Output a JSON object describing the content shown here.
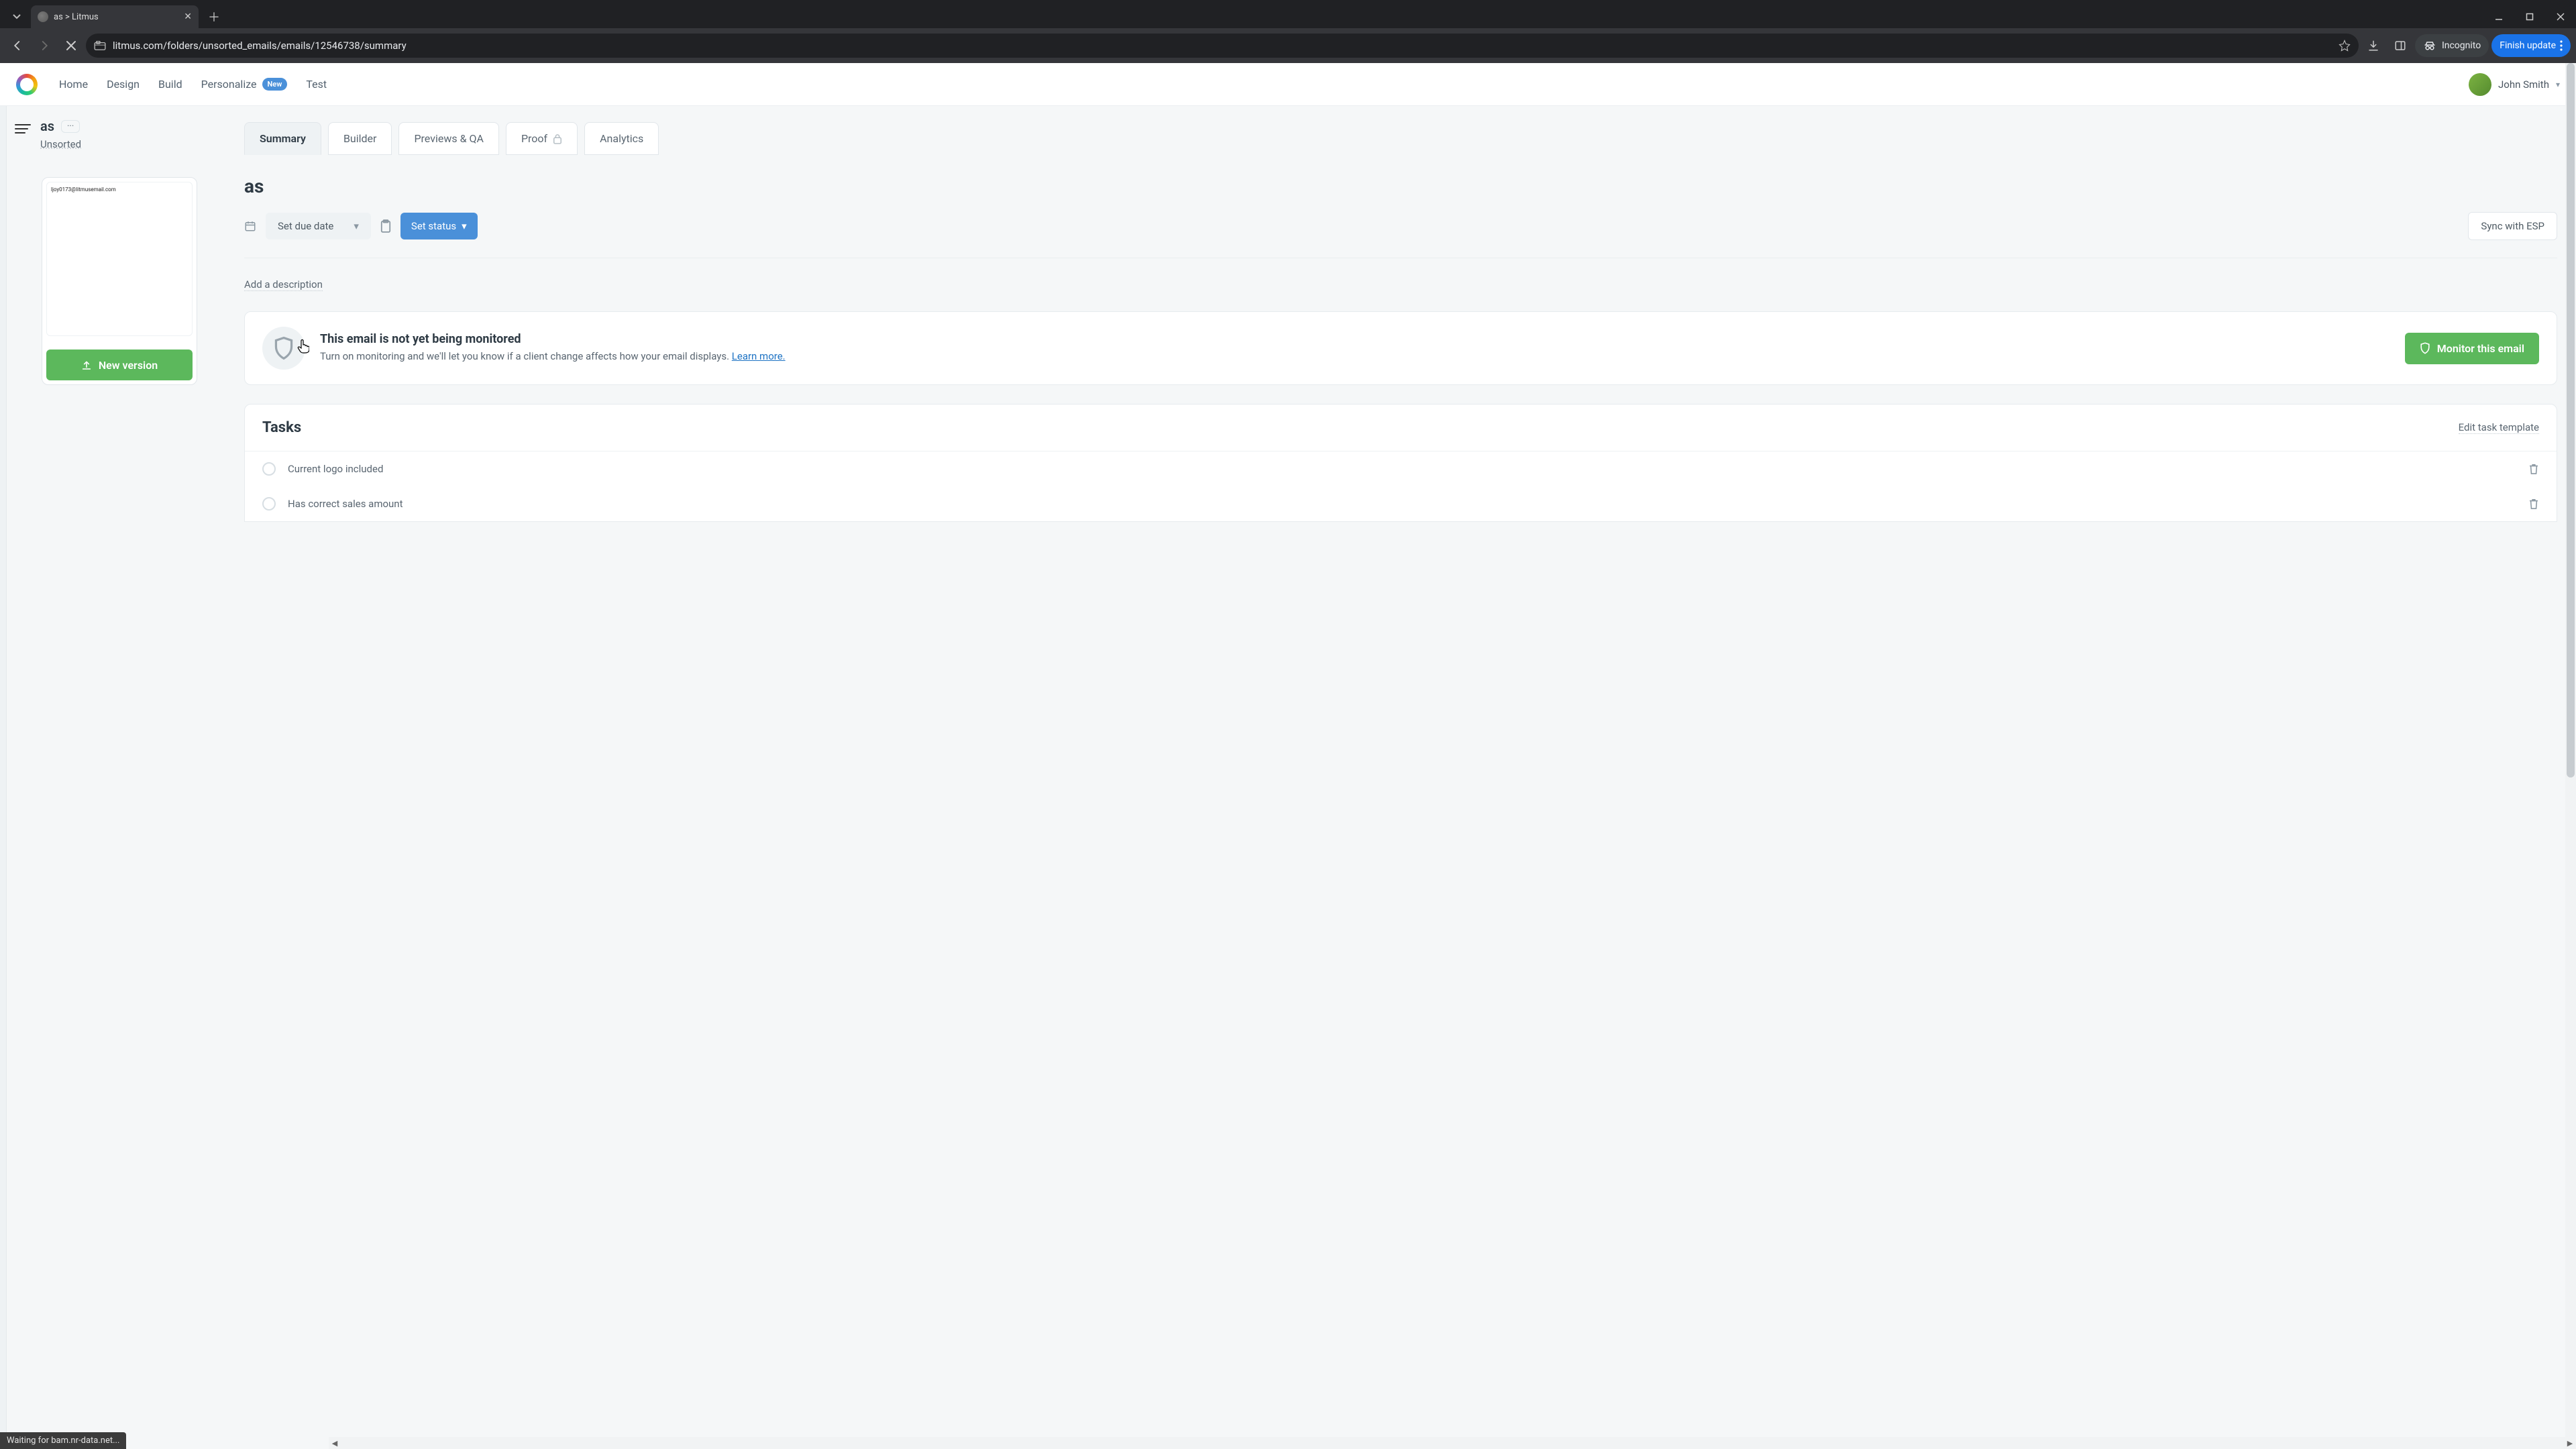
{
  "browser": {
    "tab_title": "as > Litmus",
    "url": "litmus.com/folders/unsorted_emails/emails/12546738/summary",
    "incognito_label": "Incognito",
    "finish_update_label": "Finish update",
    "status_text": "Waiting for bam.nr-data.net..."
  },
  "header": {
    "nav": {
      "home": "Home",
      "design": "Design",
      "build": "Build",
      "personalize": "Personalize",
      "personalize_badge": "New",
      "test": "Test"
    },
    "user_name": "John Smith"
  },
  "sidebar": {
    "email_title": "as",
    "more_label": "···",
    "folder_link": "Unsorted",
    "preview_text": "ljoy0173@litmusemail.com",
    "new_version_label": "New version"
  },
  "tabs": {
    "summary": "Summary",
    "builder": "Builder",
    "previews": "Previews & QA",
    "proof": "Proof",
    "analytics": "Analytics"
  },
  "main": {
    "title": "as",
    "due_date_label": "Set due date",
    "status_label": "Set status",
    "sync_label": "Sync with ESP",
    "add_description": "Add a description"
  },
  "monitor": {
    "title": "This email is not yet being monitored",
    "body": "Turn on monitoring and we'll let you know if a client change affects how your email displays. ",
    "learn_more": "Learn more.",
    "button": "Monitor this email"
  },
  "tasks": {
    "heading": "Tasks",
    "edit_template": "Edit task template",
    "items": [
      {
        "label": "Current logo included"
      },
      {
        "label": "Has correct sales amount"
      }
    ]
  }
}
